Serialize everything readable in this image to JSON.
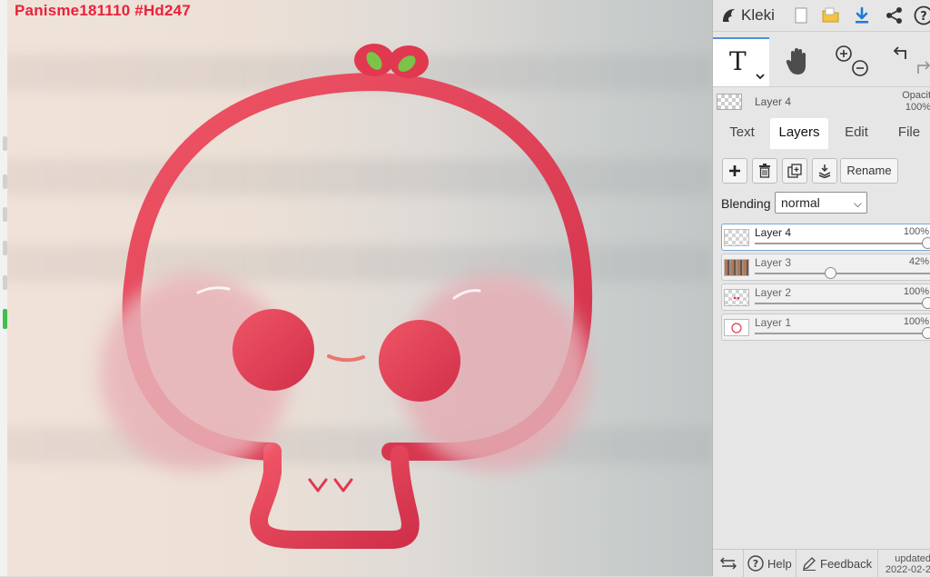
{
  "canvas": {
    "drawing_title": "Panisme181110 #Hd247"
  },
  "topbar": {
    "app_name": "Kleki",
    "icons": [
      "new-image-icon",
      "open-folder-icon",
      "download-icon",
      "share-icon",
      "help-icon"
    ]
  },
  "tools": {
    "active_tool": "text-tool",
    "active_tool_glyph": "T",
    "items": [
      "text-tool",
      "hand-tool",
      "zoom-in-icon",
      "zoom-out-icon",
      "undo-icon",
      "redo-icon"
    ]
  },
  "current_layer": {
    "name": "Layer 4",
    "opacity_label": "Opacit",
    "opacity_value": "100%"
  },
  "tabs": [
    {
      "label": "Text",
      "active": false
    },
    {
      "label": "Layers",
      "active": true
    },
    {
      "label": "Edit",
      "active": false
    },
    {
      "label": "File",
      "active": false
    }
  ],
  "layers_panel": {
    "rename_label": "Rename",
    "blending_label": "Blending",
    "blending_value": "normal",
    "layers": [
      {
        "name": "Layer 4",
        "opacity": "100%",
        "level": 1.0,
        "selected": true
      },
      {
        "name": "Layer 3",
        "opacity": "42%",
        "level": 0.42,
        "selected": false
      },
      {
        "name": "Layer 2",
        "opacity": "100%",
        "level": 1.0,
        "selected": false
      },
      {
        "name": "Layer 1",
        "opacity": "100%",
        "level": 1.0,
        "selected": false
      }
    ]
  },
  "bottombar": {
    "help_label": "Help",
    "feedback_label": "Feedback",
    "updated_line1": "updated",
    "updated_line2": "2022-02-2"
  },
  "colors": {
    "accent": "#4a90e2",
    "title_red": "#e8223a",
    "art_red": "#e0384f",
    "leaf_green": "#7cc34a"
  }
}
